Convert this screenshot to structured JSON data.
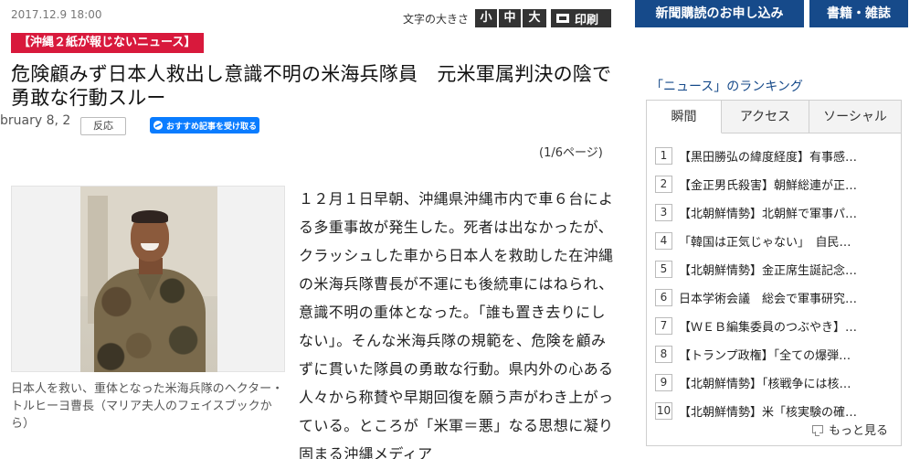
{
  "article": {
    "date": "2017.12.9 18:00",
    "font_size": {
      "label": "文字の大きさ",
      "small": "小",
      "medium": "中",
      "large": "大",
      "print": "印刷"
    },
    "category": "【沖縄２紙が報じないニュース】",
    "headline": "危険顧みず日本人救出し意識不明の米海兵隊員　元米軍属判決の陰で勇敢な行動スルー",
    "sub_date": "bruary 8, 2",
    "react_button": "反応",
    "messenger_button": "おすすめ記事を受け取る",
    "page_count": "(1/6ページ)",
    "photo_caption": "日本人を救い、重体となった米海兵隊のヘクター・トルヒーヨ曹長（マリア夫人のフェイスブックから）",
    "body": "１２月１日早朝、沖縄県沖縄市内で車６台による多重事故が発生した。死者は出なかったが、クラッシュした車から日本人を救助した在沖縄の米海兵隊曹長が不運にも後続車にはねられ、意識不明の重体となった。「誰も置き去りにしない」。そんな米海兵隊の規範を、危険を顧みずに貫いた隊員の勇敢な行動。県内外の心ある人々から称賛や早期回復を願う声がわき上がっている。ところが「米軍＝悪」なる思想に凝り固まる沖縄メディア"
  },
  "nav": {
    "subscribe": "新聞購読のお申し込み",
    "books": "書籍・雑誌"
  },
  "ranking": {
    "title": "「ニュース」のランキング",
    "tabs": [
      "瞬間",
      "アクセス",
      "ソーシャル"
    ],
    "items": [
      {
        "rank": "1",
        "text": "【黒田勝弘の緯度経度】有事感…"
      },
      {
        "rank": "2",
        "text": "【金正男氏殺害】朝鮮総連が正…"
      },
      {
        "rank": "3",
        "text": "【北朝鮮情勢】北朝鮮で軍事パ…"
      },
      {
        "rank": "4",
        "text": "「韓国は正気じゃない」　自民…"
      },
      {
        "rank": "5",
        "text": "【北朝鮮情勢】金正席生誕記念…"
      },
      {
        "rank": "6",
        "text": "日本学術会議　総会で軍事研究…"
      },
      {
        "rank": "7",
        "text": "【ＷＥＢ編集委員のつぶやき】…"
      },
      {
        "rank": "8",
        "text": "【トランプ政権】「全ての爆弾…"
      },
      {
        "rank": "9",
        "text": "【北朝鮮情勢】「核戦争には核…"
      },
      {
        "rank": "10",
        "text": "【北朝鮮情勢】米「核実験の確…"
      }
    ],
    "more": "もっと見る"
  }
}
